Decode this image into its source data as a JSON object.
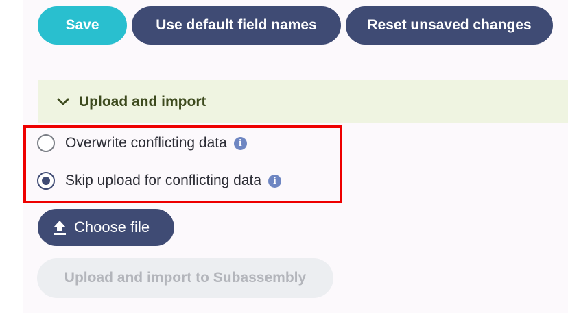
{
  "toolbar": {
    "save_label": "Save",
    "default_names_label": "Use default field names",
    "reset_label": "Reset unsaved changes"
  },
  "section": {
    "title": "Upload and import",
    "expanded": true
  },
  "conflict_options": [
    {
      "label": "Overwrite conflicting data",
      "selected": false
    },
    {
      "label": "Skip upload for conflicting data",
      "selected": true
    }
  ],
  "info_glyph": "i",
  "choose_file_label": "Choose file",
  "upload_button_label": "Upload and import to Subassembly",
  "upload_button_disabled": true,
  "colors": {
    "primary_teal": "#29bfcf",
    "navy": "#3f4b74",
    "section_bg": "#eff4e1",
    "highlight_red": "#ee0000",
    "info_blue": "#6e86c2",
    "disabled_bg": "#eceef1",
    "disabled_text": "#b3b5bb"
  },
  "icons": {
    "chevron": "chevron-down-icon",
    "info": "info-icon",
    "upload": "upload-icon"
  }
}
